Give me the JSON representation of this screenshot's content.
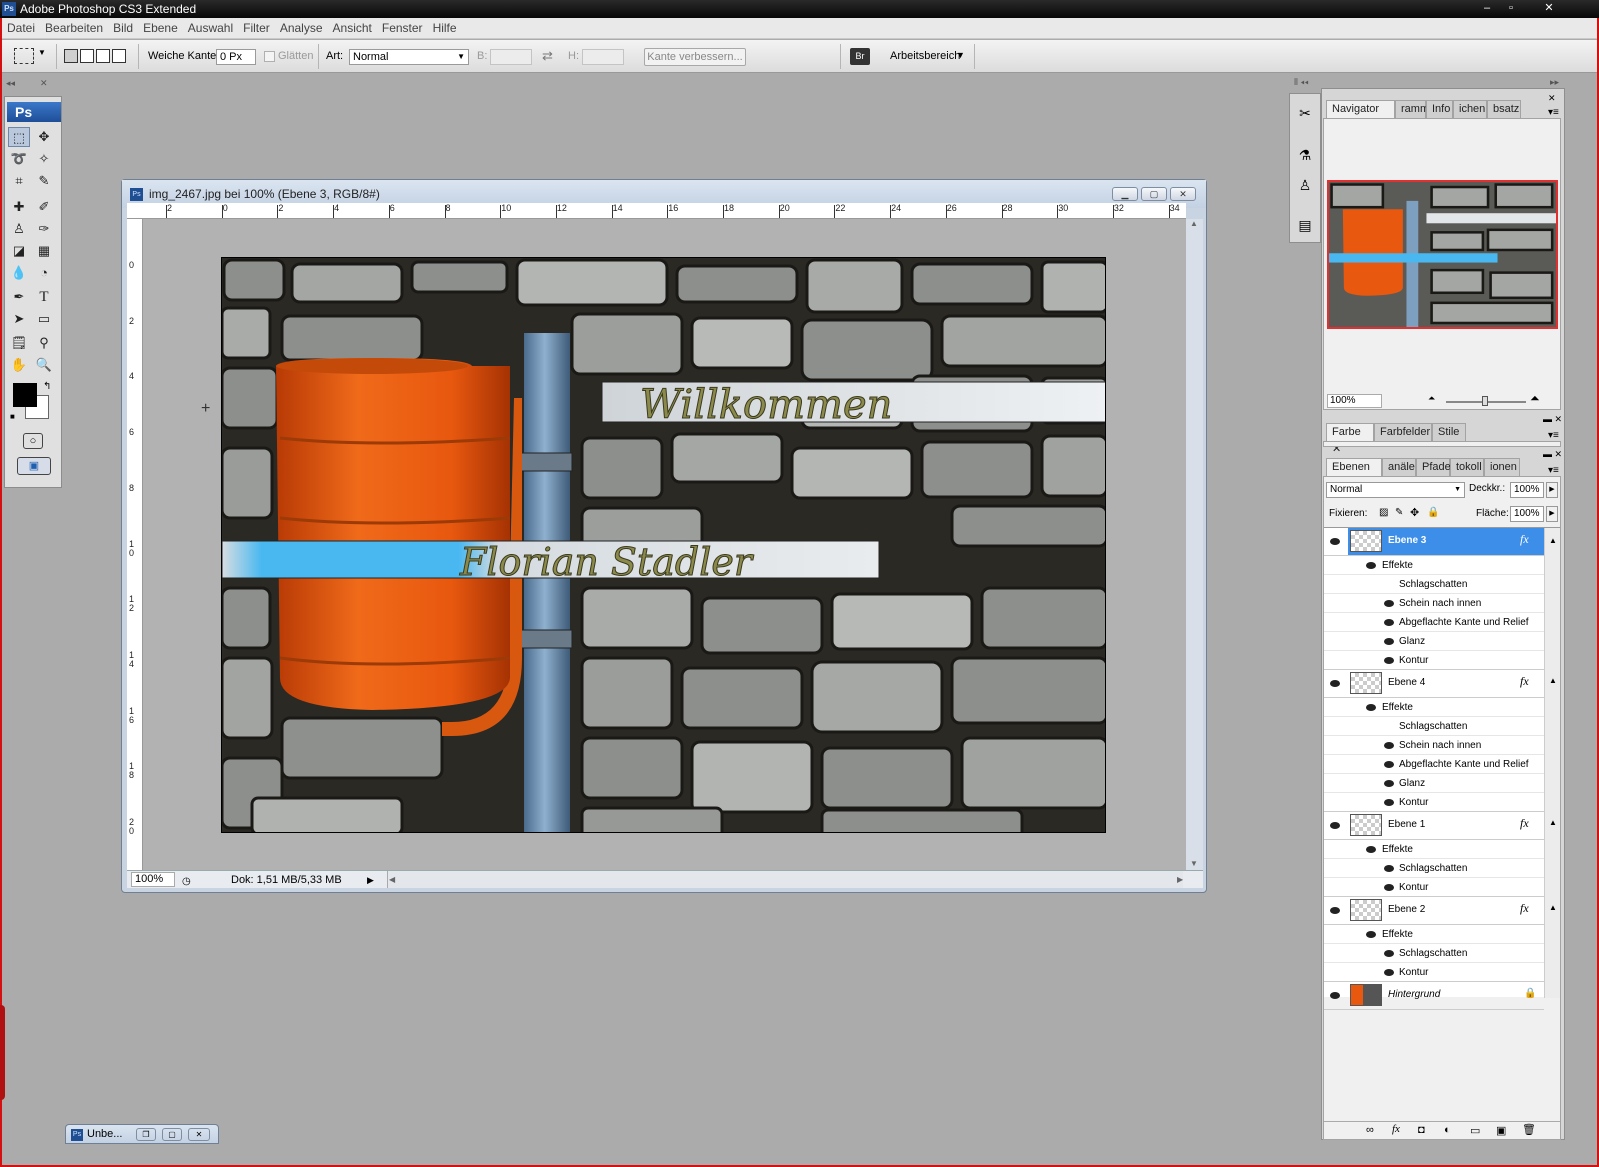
{
  "app": {
    "title": "Adobe Photoshop CS3 Extended",
    "logo": "Ps"
  },
  "window_controls": [
    "–",
    "▫",
    "✕"
  ],
  "menu": [
    "Datei",
    "Bearbeiten",
    "Bild",
    "Ebene",
    "Auswahl",
    "Filter",
    "Analyse",
    "Ansicht",
    "Fenster",
    "Hilfe"
  ],
  "options": {
    "feather_label": "Weiche Kante:",
    "feather_value": "0 Px",
    "antialias_label": "Glätten",
    "style_label": "Art:",
    "style_value": "Normal",
    "w_label": "B:",
    "h_label": "H:",
    "refine_button": "Kante verbessern...",
    "workspace_label": "Arbeitsbereich"
  },
  "toolbox": {
    "logo": "Ps"
  },
  "document": {
    "title": "img_2467.jpg bei 100% (Ebene 3, RGB/8#)",
    "zoom": "100%",
    "doc_info": "Dok: 1,51 MB/5,33 MB",
    "hruler_labels": [
      "2",
      "0",
      "2",
      "4",
      "6",
      "8",
      "10",
      "12",
      "14",
      "16",
      "18",
      "20",
      "22",
      "24",
      "26",
      "28",
      "30",
      "32",
      "34"
    ],
    "vruler_labels": [
      "0",
      "2",
      "4",
      "6",
      "8",
      "1 0",
      "1 2",
      "1 4",
      "1 6",
      "1 8",
      "2 0"
    ],
    "image_text_1": "Willkommen",
    "image_text_2": "Florian Stadler"
  },
  "navigator": {
    "tabs": [
      "Navigator",
      "ramm",
      "Info",
      "ichen",
      "bsatz"
    ],
    "zoom": "100%"
  },
  "color_panel": {
    "tabs": [
      "Farbe",
      "Farbfelder",
      "Stile"
    ]
  },
  "layers_panel": {
    "tabs": [
      "Ebenen",
      "anäle",
      "Pfade",
      "tokoll",
      "ionen"
    ],
    "blend_mode": "Normal",
    "opacity_label": "Deckkr.:",
    "opacity": "100%",
    "lock_label": "Fixieren:",
    "fill_label": "Fläche:",
    "fill": "100%",
    "layers": [
      {
        "name": "Ebene 3",
        "fx": "fx",
        "effects_label": "Effekte",
        "effects": [
          "Schlagschatten",
          "Schein nach innen",
          "Abgeflachte Kante und Relief",
          "Glanz",
          "Kontur"
        ]
      },
      {
        "name": "Ebene 4",
        "fx": "fx",
        "effects_label": "Effekte",
        "effects": [
          "Schlagschatten",
          "Schein nach innen",
          "Abgeflachte Kante und Relief",
          "Glanz",
          "Kontur"
        ]
      },
      {
        "name": "Ebene 1",
        "fx": "fx",
        "effects_label": "Effekte",
        "effects": [
          "Schlagschatten",
          "Kontur"
        ]
      },
      {
        "name": "Ebene 2",
        "fx": "fx",
        "effects_label": "Effekte",
        "effects": [
          "Schlagschatten",
          "Kontur"
        ]
      },
      {
        "name": "Hintergrund"
      }
    ],
    "footer_icons": [
      "∞",
      "fx",
      "◘",
      "◐",
      "▭",
      "▣",
      "🗑"
    ]
  },
  "taskbar": {
    "minimized_doc": "Unbe..."
  },
  "colors": {
    "accent": "#3d8ee8",
    "bin_orange": "#e8580f",
    "pole": "#6f93b5",
    "selection": "#4a9df0"
  }
}
